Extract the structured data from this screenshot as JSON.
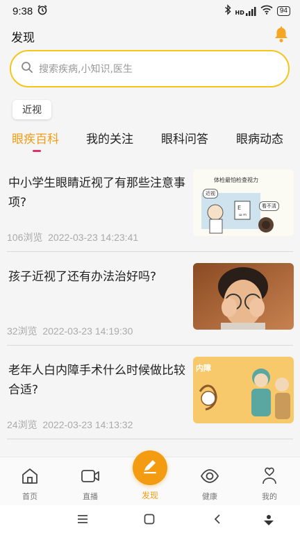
{
  "status_bar": {
    "time": "9:38",
    "network": "HD",
    "battery": "94"
  },
  "header": {
    "title": "发现"
  },
  "search": {
    "placeholder": "搜索疾病,小知识,医生"
  },
  "tag": {
    "label": "近视"
  },
  "tabs": [
    {
      "label": "眼疾百科",
      "active": true
    },
    {
      "label": "我的关注",
      "active": false
    },
    {
      "label": "眼科问答",
      "active": false
    },
    {
      "label": "眼病动态",
      "active": false
    }
  ],
  "articles": [
    {
      "title": "中小学生眼睛近视了有那些注意事项?",
      "views": "106浏览",
      "datetime": "2022-03-23 14:23:41",
      "thumb_caption": "体检最怕检查视力",
      "thumb_bubble_1": "近视",
      "thumb_bubble_2": "看不清"
    },
    {
      "title": "孩子近视了还有办法治好吗?",
      "views": "32浏览",
      "datetime": "2022-03-23 14:19:30"
    },
    {
      "title": "老年人白内障手术什么时候做比较合适?",
      "views": "24浏览",
      "datetime": "2022-03-23 14:13:32",
      "thumb_caption": "内障"
    }
  ],
  "bottom_nav": [
    {
      "label": "首页",
      "icon": "home-icon"
    },
    {
      "label": "直播",
      "icon": "video-camera-icon"
    },
    {
      "label": "发现",
      "icon": "pencil-icon",
      "active": true
    },
    {
      "label": "健康",
      "icon": "eye-icon"
    },
    {
      "label": "我的",
      "icon": "person-heart-icon"
    }
  ],
  "colors": {
    "accent": "#f39c12",
    "search_border": "#f5c518",
    "tab_indicator": "#e0306a"
  }
}
